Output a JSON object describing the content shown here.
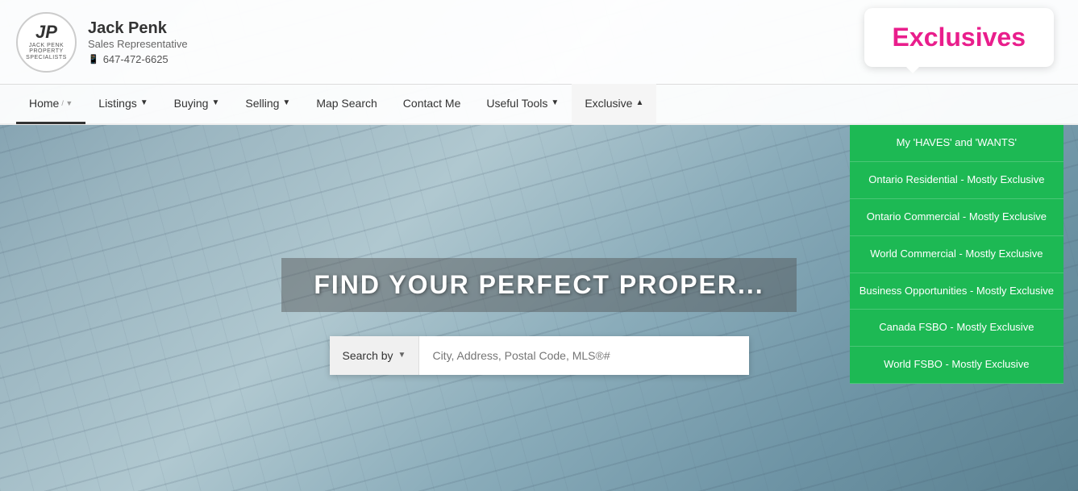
{
  "header": {
    "logo_jp": "JP",
    "logo_subtitle": "JACK PENK\nPROPERTY SPECIALISTS",
    "agent_name": "Jack Penk",
    "agent_title": "Sales Representative",
    "agent_phone": "647-472-6625"
  },
  "speech_bubble": {
    "text": "Exclusives"
  },
  "navbar": {
    "items": [
      {
        "label": "Home",
        "has_dropdown": false,
        "active": false
      },
      {
        "label": "Listings",
        "has_dropdown": true,
        "active": false
      },
      {
        "label": "Buying",
        "has_dropdown": true,
        "active": false
      },
      {
        "label": "Selling",
        "has_dropdown": true,
        "active": false
      },
      {
        "label": "Map Search",
        "has_dropdown": false,
        "active": false
      },
      {
        "label": "Contact Me",
        "has_dropdown": false,
        "active": false
      },
      {
        "label": "Useful Tools",
        "has_dropdown": true,
        "active": false
      },
      {
        "label": "Exclusive",
        "has_dropdown": true,
        "active": true
      }
    ]
  },
  "exclusive_dropdown": {
    "items": [
      {
        "label": "My 'HAVES' and 'WANTS'"
      },
      {
        "label": "Ontario Residential - Mostly Exclusive"
      },
      {
        "label": "Ontario Commercial - Mostly Exclusive"
      },
      {
        "label": "World Commercial - Mostly Exclusive"
      },
      {
        "label": "Business Opportunities - Mostly Exclusive"
      },
      {
        "label": "Canada FSBO - Mostly Exclusive"
      },
      {
        "label": "World FSBO - Mostly Exclusive"
      }
    ]
  },
  "hero": {
    "title": "FIND YOUR PERFECT PROPER...",
    "search_placeholder": "City, Address, Postal Code, MLS®#",
    "search_by_label": "Search by"
  }
}
